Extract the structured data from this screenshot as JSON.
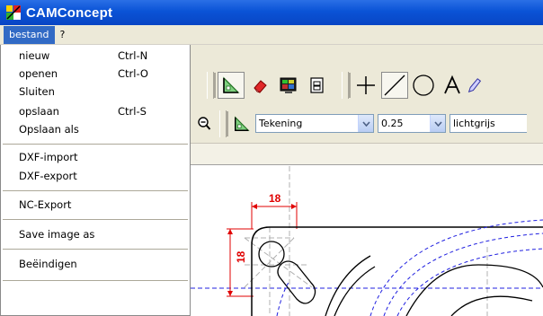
{
  "window": {
    "title": "CAMConcept"
  },
  "menubar": {
    "items": [
      {
        "label": "bestand"
      },
      {
        "label": "?"
      }
    ]
  },
  "file_menu": {
    "items": [
      {
        "label": "nieuw",
        "shortcut": "Ctrl-N"
      },
      {
        "label": "openen",
        "shortcut": "Ctrl-O"
      },
      {
        "label": "Sluiten",
        "shortcut": ""
      },
      {
        "label": "opslaan",
        "shortcut": "Ctrl-S"
      },
      {
        "label": "Opslaan als",
        "shortcut": ""
      },
      {
        "label": "DXF-import",
        "shortcut": ""
      },
      {
        "label": "DXF-export",
        "shortcut": ""
      },
      {
        "label": "NC-Export",
        "shortcut": ""
      },
      {
        "label": "Save image as",
        "shortcut": ""
      },
      {
        "label": "Beëindigen",
        "shortcut": ""
      }
    ]
  },
  "toolbar2": {
    "layer_value": "Tekening",
    "width_value": "0.25",
    "color_value": "lichtgrijs"
  },
  "drawing": {
    "dim_horizontal": "18",
    "dim_vertical": "18"
  },
  "colors": {
    "title_bar": "#0a53d6",
    "menu_highlight": "#316ac5",
    "dimension": "#e00000",
    "hidden_lines": "#2020e0"
  },
  "icons": [
    "camconcept-app-icon",
    "snap-grid-icon",
    "eraser-icon",
    "monitor-icon",
    "layers-icon",
    "crosshair-icon",
    "line-icon",
    "circle-icon",
    "text-icon",
    "pencil-icon",
    "zoom-out-icon",
    "dropdown-arrow-icon"
  ]
}
